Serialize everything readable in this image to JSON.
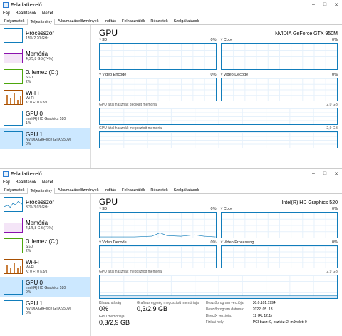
{
  "win1": {
    "title": "Feladatkezelő",
    "menu": [
      "Fájl",
      "Beállítások",
      "Nézet"
    ],
    "tabs": [
      "Folyamatok",
      "Teljesítmény",
      "Alkalmazáselőzmények",
      "Indítás",
      "Felhasználók",
      "Részletek",
      "Szolgáltatások"
    ],
    "sidebar": [
      {
        "name": "Processzor",
        "sub1": "15% 2,20 GHz",
        "sub2": ""
      },
      {
        "name": "Memória",
        "sub1": "4,3/5,8 GB (74%)",
        "sub2": ""
      },
      {
        "name": "0. lemez (C:)",
        "sub1": "SSD",
        "sub2": "2%"
      },
      {
        "name": "Wi-Fi",
        "sub1": "Wi-Fi",
        "sub2": "K: 0  F: 0 Kb/s"
      },
      {
        "name": "GPU 0",
        "sub1": "Intel(R) HD Graphics 520",
        "sub2": "1%"
      },
      {
        "name": "GPU 1",
        "sub1": "NVIDIA GeForce GTX 950M",
        "sub2": "0%"
      }
    ],
    "main": {
      "title": "GPU",
      "model": "NVIDIA GeForce GTX 950M",
      "graphs": [
        {
          "label": "3D",
          "pct": "0%"
        },
        {
          "label": "Copy",
          "pct": "0%"
        },
        {
          "label": "Video Encode",
          "pct": "0%"
        },
        {
          "label": "Video Decode",
          "pct": "0%"
        }
      ],
      "dedicated_label": "GPU által használt dedikált memória",
      "dedicated_max": "2,0 GB",
      "shared_label": "GPU által használt megosztott memória",
      "shared_max": "2,9 GB"
    }
  },
  "win2": {
    "title": "Feladatkezelő",
    "menu": [
      "Fájl",
      "Beállítások",
      "Nézet"
    ],
    "tabs": [
      "Folyamatok",
      "Teljesítmény",
      "Alkalmazáselőzmények",
      "Indítás",
      "Felhasználók",
      "Részletek",
      "Szolgáltatások"
    ],
    "sidebar": [
      {
        "name": "Processzor",
        "sub1": "37% 3,03 GHz",
        "sub2": ""
      },
      {
        "name": "Memória",
        "sub1": "4,1/5,8 GB (71%)",
        "sub2": ""
      },
      {
        "name": "0. lemez (C:)",
        "sub1": "SSD",
        "sub2": "2%"
      },
      {
        "name": "Wi-Fi",
        "sub1": "Wi-Fi",
        "sub2": "K: 0  F: 0 Kb/s"
      },
      {
        "name": "GPU 0",
        "sub1": "Intel(R) HD Graphics 520",
        "sub2": "0%"
      },
      {
        "name": "GPU 1",
        "sub1": "NVIDIA GeForce GTX 950M",
        "sub2": "0%"
      }
    ],
    "main": {
      "title": "GPU",
      "model": "Intel(R) HD Graphics 520",
      "graphs": [
        {
          "label": "3D",
          "pct": "0%"
        },
        {
          "label": "Copy",
          "pct": "0%"
        },
        {
          "label": "Video Decode",
          "pct": "0%"
        },
        {
          "label": "Video Processing",
          "pct": "0%"
        }
      ],
      "shared_label": "GPU által használt megosztott memória",
      "shared_max": "2,9 GB",
      "stats": {
        "util_label": "Kihasználtság",
        "util_value": "0%",
        "shared_label": "Grafikus egység megosztott memóriája",
        "shared_value": "0,3/2,9 GB",
        "gpumem_label": "GPU memóriája",
        "gpumem_value": "0,3/2,9 GB"
      },
      "props": [
        {
          "k": "Illesztőprogram verziója:",
          "v": "30.0.101.1994"
        },
        {
          "k": "Illesztőprogram dátuma:",
          "v": "2022. 05. 13."
        },
        {
          "k": "DirectX verziója:",
          "v": "12 (FL 12.1)"
        },
        {
          "k": "Fizikai hely:",
          "v": "PCI-busz: 0, eszköz: 2, művelet: 0"
        }
      ]
    }
  },
  "colors": {
    "accent": "#117dbb",
    "memory": "#8b12ae",
    "disk": "#4da60c",
    "network": "#a74f01",
    "selected": "#cce8ff"
  }
}
